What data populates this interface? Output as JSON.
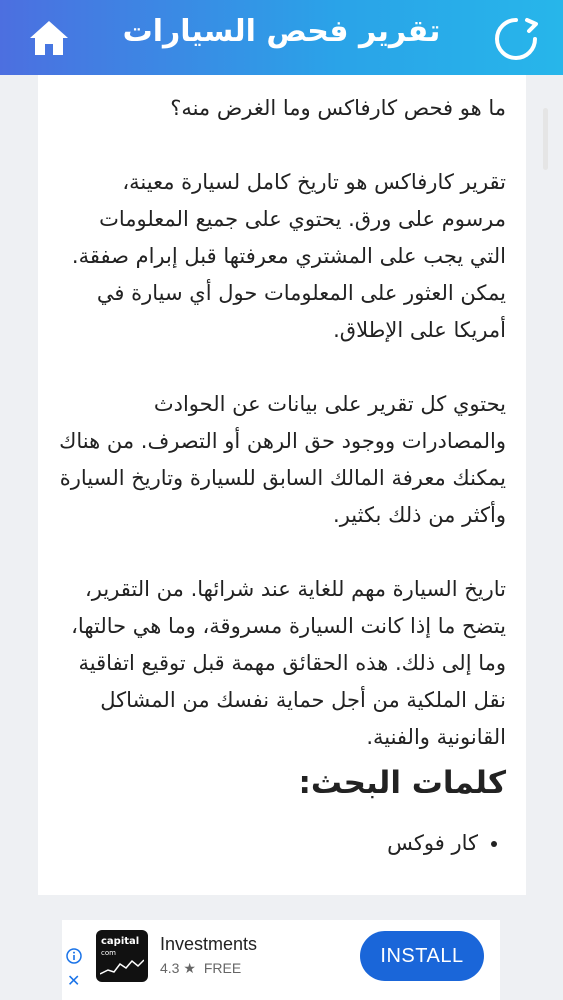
{
  "header": {
    "title": "تقرير فحص السيارات",
    "home_icon": "home-icon",
    "refresh_icon": "refresh-icon",
    "color_start": "#4c6fe0",
    "color_end": "#27b6ea"
  },
  "article": {
    "paragraphs": [
      "ما هو فحص كارفاكس وما الغرض منه؟",
      "تقرير كارفاكس هو تاريخ كامل لسيارة معينة، مرسوم على ورق. يحتوي على جميع المعلومات التي يجب على المشتري معرفتها قبل إبرام صفقة. يمكن العثور على المعلومات حول أي سيارة في أمريكا على الإطلاق.",
      "يحتوي كل تقرير على بيانات عن الحوادث والمصادرات ووجود حق الرهن أو التصرف. من هناك يمكنك معرفة المالك السابق للسيارة وتاريخ السيارة وأكثر من ذلك بكثير.",
      "تاريخ السيارة مهم للغاية عند شرائها. من التقرير، يتضح ما إذا كانت السيارة مسروقة، وما هي حالتها، وما إلى ذلك. هذه الحقائق مهمة قبل توقيع اتفاقية نقل الملكية من أجل حماية نفسك من المشاكل القانونية والفنية."
    ],
    "keywords_heading": "كلمات البحث:",
    "keywords": [
      "كار فوكس"
    ]
  },
  "ad": {
    "logo_text": "capital",
    "logo_sub": "com",
    "app_name": "Investments",
    "rating": "4.3",
    "star_icon": "star-icon",
    "price": "FREE",
    "install_label": "INSTALL",
    "install_color": "#1a66d9",
    "info_icon": "info-icon",
    "close_icon": "close-icon"
  }
}
